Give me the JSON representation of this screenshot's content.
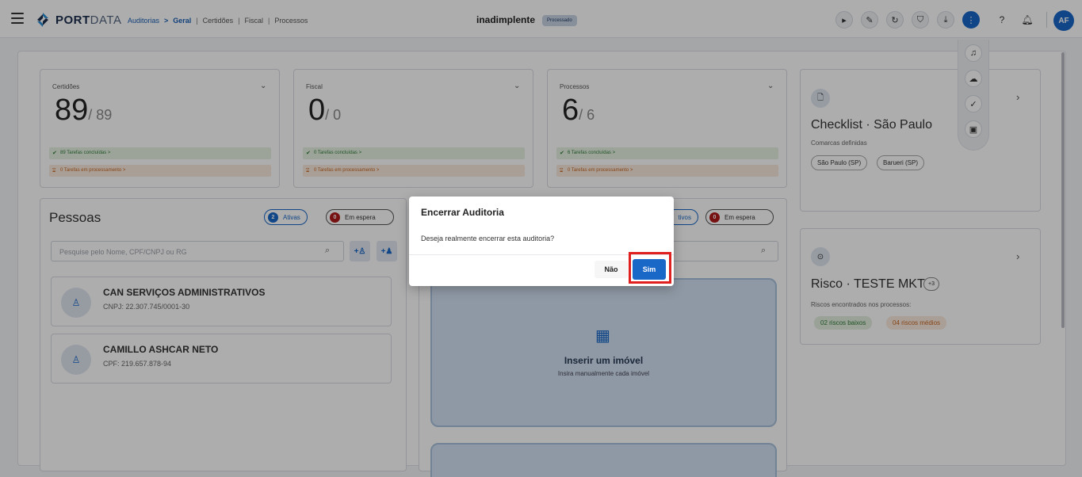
{
  "header": {
    "brand_bold": "PORT",
    "brand_light": "DATA",
    "breadcrumbs": [
      "Auditorias",
      "Geral",
      "Certidões",
      "Fiscal",
      "Processos"
    ],
    "title": "inadimplente",
    "status_badge": "Processado",
    "avatar_initials": "AF",
    "toolbar_icons": [
      "play-icon",
      "edit-icon",
      "refresh-icon",
      "shield-icon",
      "download-icon",
      "more-vertical-icon",
      "help-icon",
      "bell-icon"
    ],
    "floating_icons": [
      "bell-settings-icon",
      "cloud-upload-icon",
      "verified-icon",
      "money-icon"
    ]
  },
  "stats": [
    {
      "label": "Certidões",
      "value": "89",
      "total": "/ 89",
      "done": "89 Tarefas concluídas  >",
      "processing": "0 Tarefas em processamento  >"
    },
    {
      "label": "Fiscal",
      "value": "0",
      "total": "/ 0",
      "done": "0 Tarefas concluídas  >",
      "processing": "0 Tarefas em processamento  >"
    },
    {
      "label": "Processos",
      "value": "6",
      "total": "/ 6",
      "done": "6 Tarefas concluídas  >",
      "processing": "0 Tarefas em processamento  >"
    }
  ],
  "pessoas": {
    "title": "Pessoas",
    "active_count": "2",
    "active_label": "Ativas",
    "waiting_count": "0",
    "waiting_label": "Em espera",
    "search_placeholder": "Pesquise pelo Nome, CPF/CNPJ ou RG",
    "items": [
      {
        "name": "CAN SERVIÇOS ADMINISTRATIVOS",
        "doc": "CNPJ: 22.307.745/0001-30"
      },
      {
        "name": "CAMILLO ASHCAR NETO",
        "doc": "CPF: 219.657.878-94"
      }
    ]
  },
  "imoveis": {
    "active_label_partial": "tivos",
    "waiting_count": "0",
    "waiting_label": "Em espera",
    "insert_title": "Inserir um imóvel",
    "insert_sub": "Insira manualmente cada imóvel"
  },
  "checklist": {
    "title": "Checklist · São Paulo",
    "subtitle": "Comarcas definidas",
    "chips": [
      "São Paulo (SP)",
      "Barueri (SP)"
    ]
  },
  "risco": {
    "title": "Risco · TESTE MKT",
    "badge": "+3",
    "subtitle": "Riscos encontrados nos processos:",
    "low": "02 riscos baixos",
    "medium": "04 riscos médios"
  },
  "dialog": {
    "title": "Encerrar Auditoria",
    "message": "Deseja realmente encerrar esta auditoria?",
    "no_label": "Não",
    "yes_label": "Sim"
  }
}
